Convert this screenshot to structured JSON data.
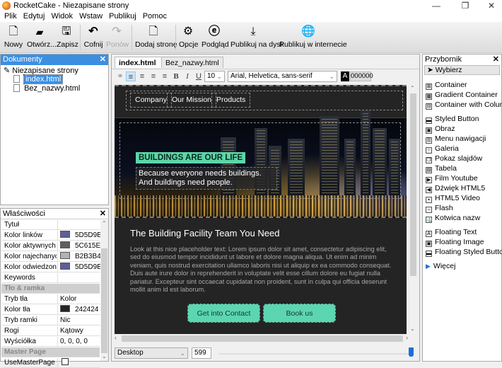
{
  "window": {
    "title": "RocketCake - Niezapisane strony",
    "controls": {
      "minimize": "—",
      "maximize": "❐",
      "close": "✕"
    }
  },
  "menu": [
    "Plik",
    "Edytuj",
    "Widok",
    "Wstaw",
    "Publikuj",
    "Pomoc"
  ],
  "toolbar": {
    "new": {
      "label": "Nowy",
      "icon": "new-file-icon"
    },
    "open": {
      "label": "Otwórz...",
      "icon": "folder-open-icon"
    },
    "save": {
      "label": "Zapisz",
      "icon": "save-icon"
    },
    "undo": {
      "label": "Cofnij",
      "icon": "undo-icon"
    },
    "redo": {
      "label": "Ponów",
      "icon": "redo-icon"
    },
    "add_page": {
      "label": "Dodaj stronę",
      "icon": "add-page-icon"
    },
    "options": {
      "label": "Opcje",
      "icon": "gear-icon"
    },
    "preview": {
      "label": "Podgląd",
      "icon": "preview-icon"
    },
    "publish_disk": {
      "label": "Publikuj na dysk",
      "icon": "download-icon"
    },
    "publish_web": {
      "label": "Publikuj w internecie",
      "icon": "globe-icon"
    }
  },
  "documents": {
    "title": "Dokumenty",
    "root": "Niezapisane strony",
    "files": [
      "index.html",
      "Bez_nazwy.html"
    ],
    "selected": "index.html"
  },
  "properties": {
    "title": "Właściwości",
    "rows": [
      {
        "key": "Tytuł",
        "value": ""
      },
      {
        "key": "Kolor linków",
        "value": "5D5D9E",
        "color": "#5D5D9E"
      },
      {
        "key": "Kolor aktywnych linków",
        "value": "5C615E",
        "color": "#5C615E"
      },
      {
        "key": "Kolor najechanych linków",
        "value": "B2B3B4",
        "color": "#B2B3B4"
      },
      {
        "key": "Kolor odwiedzonych linków",
        "value": "5D5D9E",
        "color": "#5D5D9E"
      },
      {
        "key": "Keywords",
        "value": ""
      },
      {
        "category": "Tło & ramka"
      },
      {
        "key": "Tryb tła",
        "value": "Kolor"
      },
      {
        "key": "Kolor tła",
        "value": "242424",
        "color": "#242424"
      },
      {
        "key": "Tryb ramki",
        "value": "Nic"
      },
      {
        "key": "Rogi",
        "value": "Kątowy"
      },
      {
        "key": "Wyściółka",
        "value": "0, 0, 0, 0"
      },
      {
        "category": "Master Page"
      },
      {
        "key": "UseMasterPage",
        "value": "",
        "checkbox": false
      }
    ]
  },
  "editor": {
    "tabs": [
      {
        "label": "index.html",
        "active": true,
        "close": "✕"
      },
      {
        "label": "Bez_nazwy.html",
        "active": false
      }
    ],
    "format": {
      "font_size": "10",
      "font_family": "Arial, Helvetica, sans-serif",
      "text_color_label": "A",
      "text_color": "000000",
      "bold": "B",
      "italic": "I",
      "underline": "U"
    },
    "page": {
      "nav": [
        "Company",
        "Our Mission",
        "Products"
      ],
      "hero_tag": "BUILDINGS ARE OUR LIFE",
      "hero_sub": "Because everyone needs buildings. And buildings need people.",
      "heading": "The Building Facility Team You Need",
      "paragraph": "Look at this nice placeholder text: Lorem ipsum dolor sit amet, consectetur adipiscing elit, sed do eiusmod tempor incididunt ut labore et dolore magna aliqua. Ut enim ad minim veniam, quis nostrud exercitation ullamco laboris nisi ut aliquip ex ea commodo consequat. Duis aute irure dolor in reprehenderit in voluptate velit esse cillum dolore eu fugiat nulla pariatur. Excepteur sint occaecat cupidatat non proident, sunt in culpa qui officia deserunt mollit anim id est laborum.",
      "buttons": [
        "Get into Contact",
        "Book us"
      ],
      "accent": "#5CD6B0",
      "background": "#242424"
    },
    "bottom": {
      "device": "Desktop",
      "width": "599",
      "slider_fraction": 1.0
    }
  },
  "toolbox": {
    "title": "Przybornik",
    "select": "Wybierz",
    "groups": [
      [
        "Container",
        "Gradient Container",
        "Container with Columns"
      ],
      [
        "Styled Button",
        "Obraz",
        "Menu nawigacji",
        "Galeria",
        "Pokaz slajdów",
        "Tabela",
        "Film Youtube",
        "Dźwięk HTML5",
        "HTML5 Video",
        "Flash",
        "Kotwica nazw"
      ],
      [
        "Floating Text",
        "Floating Image",
        "Floating Styled Button"
      ]
    ],
    "more": "Więcej"
  }
}
